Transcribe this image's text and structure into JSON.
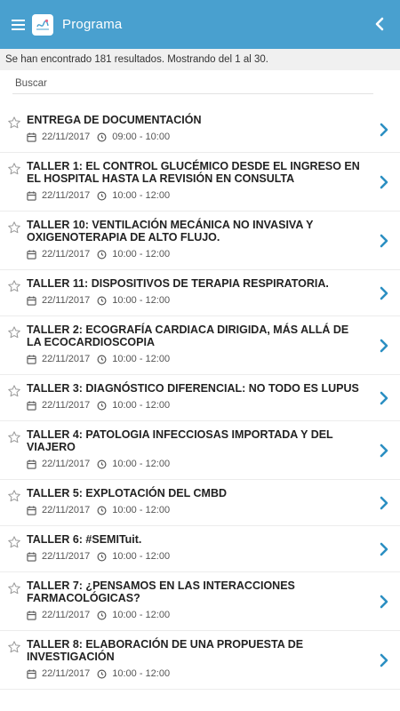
{
  "header": {
    "title": "Programa",
    "menu_icon": "hamburger-icon",
    "logo_icon": "app-logo-icon",
    "back_icon": "chevron-left-icon",
    "bg_color": "#49a0cf"
  },
  "results": {
    "text": "Se han encontrado 181 resultados. Mostrando del 1 al 30."
  },
  "search": {
    "placeholder": "Buscar",
    "value": ""
  },
  "accent_color": "#2b8fc2",
  "items": [
    {
      "title": "ENTREGA DE DOCUMENTACIÓN",
      "date": "22/11/2017",
      "time": "09:00 - 10:00"
    },
    {
      "title": "TALLER 1: EL CONTROL GLUCÉMICO DESDE EL INGRESO EN EL HOSPITAL HASTA LA REVISIÓN EN CONSULTA",
      "date": "22/11/2017",
      "time": "10:00 - 12:00"
    },
    {
      "title": "TALLER 10: VENTILACIÓN MECÁNICA NO INVASIVA Y OXIGENOTERAPIA DE ALTO FLUJO.",
      "date": "22/11/2017",
      "time": "10:00 - 12:00"
    },
    {
      "title": "TALLER 11: DISPOSITIVOS DE TERAPIA RESPIRATORIA.",
      "date": "22/11/2017",
      "time": "10:00 - 12:00"
    },
    {
      "title": "TALLER 2: ECOGRAFÍA CARDIACA DIRIGIDA, MÁS ALLÁ DE LA ECOCARDIOSCOPIA",
      "date": "22/11/2017",
      "time": "10:00 - 12:00"
    },
    {
      "title": "TALLER 3: DIAGNÓSTICO DIFERENCIAL: NO TODO ES LUPUS",
      "date": "22/11/2017",
      "time": "10:00 - 12:00"
    },
    {
      "title": "TALLER 4: PATOLOGIA INFECCIOSAS IMPORTADA Y DEL VIAJERO",
      "date": "22/11/2017",
      "time": "10:00 - 12:00"
    },
    {
      "title": "TALLER 5: EXPLOTACIÓN DEL CMBD",
      "date": "22/11/2017",
      "time": "10:00 - 12:00"
    },
    {
      "title": "TALLER 6: #SEMITuit.",
      "date": "22/11/2017",
      "time": "10:00 - 12:00"
    },
    {
      "title": "TALLER 7: ¿PENSAMOS EN LAS INTERACCIONES FARMACOLÓGICAS?",
      "date": "22/11/2017",
      "time": "10:00 - 12:00"
    },
    {
      "title": "TALLER 8: ELABORACIÓN DE UNA PROPUESTA DE INVESTIGACIÓN",
      "date": "22/11/2017",
      "time": "10:00 - 12:00"
    }
  ]
}
